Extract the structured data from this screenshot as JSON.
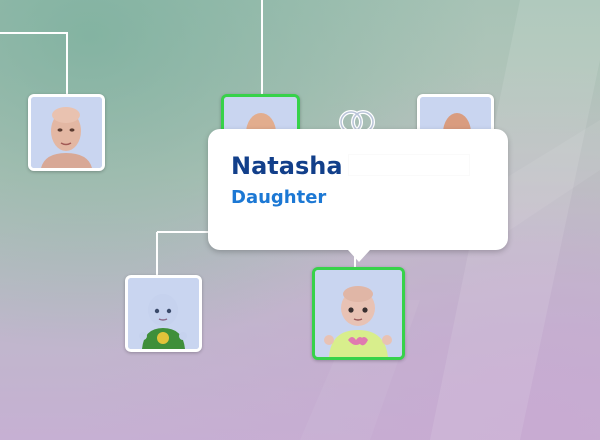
{
  "tooltip": {
    "first_name": "Natasha",
    "relationship": "Daughter"
  },
  "portraits": [
    {
      "role": "adult-female-left",
      "selected": false
    },
    {
      "role": "parent-top-selected-frame",
      "selected": true
    },
    {
      "role": "adult-right",
      "selected": false
    },
    {
      "role": "toddler-boy",
      "selected": false
    },
    {
      "role": "toddler-girl",
      "selected": true
    }
  ],
  "colors": {
    "selected_border": "#37d24a",
    "name_text": "#123f8a",
    "relationship_text": "#1c78d4",
    "connector_line": "#ffffff"
  },
  "icons": [
    "wedding-rings-icon"
  ]
}
